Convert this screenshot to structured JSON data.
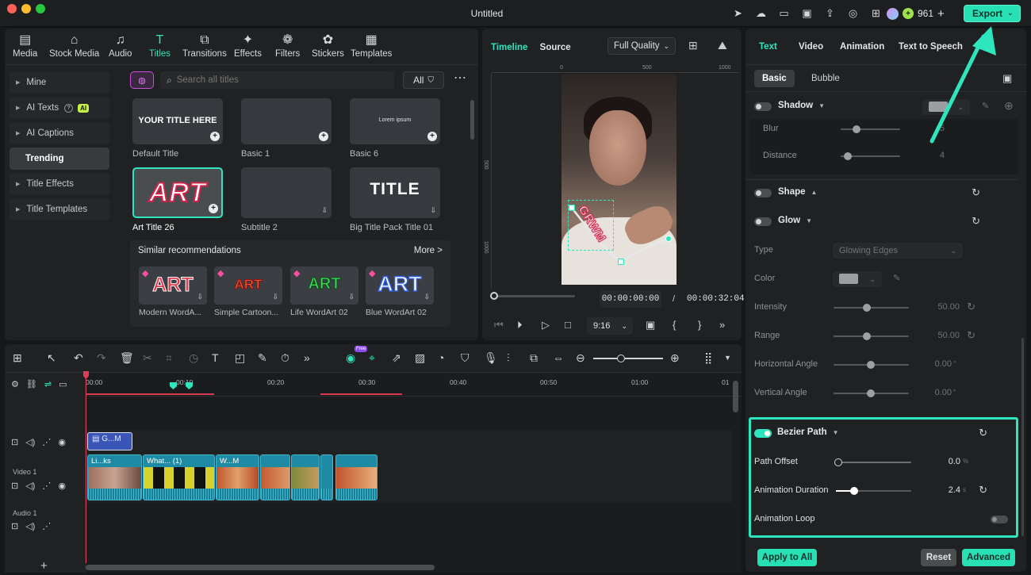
{
  "window": {
    "title": "Untitled"
  },
  "topbar": {
    "credits": "961",
    "credit_plus": "+",
    "export_label": "Export",
    "icons": [
      "send-icon",
      "cloud-sync-icon",
      "monitor-icon",
      "save-icon",
      "cloud-upload-icon",
      "headset-icon",
      "grid-icon"
    ]
  },
  "media_tabs": [
    {
      "label": "Media",
      "icon": "media-icon"
    },
    {
      "label": "Stock Media",
      "icon": "stock-media-icon"
    },
    {
      "label": "Audio",
      "icon": "music-note-icon"
    },
    {
      "label": "Titles",
      "icon": "titles-icon",
      "active": true
    },
    {
      "label": "Transitions",
      "icon": "transitions-icon"
    },
    {
      "label": "Effects",
      "icon": "effects-icon"
    },
    {
      "label": "Filters",
      "icon": "filters-icon"
    },
    {
      "label": "Stickers",
      "icon": "stickers-icon"
    },
    {
      "label": "Templates",
      "icon": "templates-icon"
    }
  ],
  "sidebar": {
    "items": [
      {
        "label": "Mine"
      },
      {
        "label": "AI Texts",
        "badge": "AI"
      },
      {
        "label": "AI Captions"
      },
      {
        "label": "Trending",
        "active": true
      },
      {
        "label": "Title Effects"
      },
      {
        "label": "Title Templates"
      }
    ]
  },
  "search": {
    "placeholder": "Search all titles",
    "filter_label": "All"
  },
  "title_cards": [
    {
      "caption": "Default Title",
      "thumb_text": "YOUR TITLE HERE"
    },
    {
      "caption": "Basic 1",
      "thumb_text": ""
    },
    {
      "caption": "Basic 6",
      "thumb_text": "Lorem ipsum"
    },
    {
      "caption": "Art Title 26",
      "thumb_text": "ART",
      "selected": true
    },
    {
      "caption": "Subtitle 2",
      "thumb_text": ""
    },
    {
      "caption": "Big Title Pack Title 01",
      "thumb_text": "TITLE"
    }
  ],
  "recommendations": {
    "title": "Similar recommendations",
    "more": "More >",
    "items": [
      {
        "caption": "Modern WordA...",
        "thumb_text": "ART",
        "color": "#e33a4d"
      },
      {
        "caption": "Simple Cartoon...",
        "thumb_text": "ART",
        "color": "#f05b2b"
      },
      {
        "caption": "Life WordArt 02",
        "thumb_text": "ART",
        "color": "#3ee05a"
      },
      {
        "caption": "Blue WordArt 02",
        "thumb_text": "ART",
        "color": "#ffffff"
      }
    ]
  },
  "preview": {
    "tabs": [
      "Timeline",
      "Source"
    ],
    "quality": "Full Quality",
    "ruler_h": [
      "0",
      "500",
      "1000"
    ],
    "ruler_v": [
      "500",
      "1000"
    ],
    "overlay_text": "GRWM",
    "current_time": "00:00:00:00",
    "time_sep": "/",
    "total_time": "00:00:32:04",
    "ratio": "9:16"
  },
  "properties": {
    "tabs": [
      "Text",
      "Video",
      "Animation",
      "Text to Speech"
    ],
    "subtabs": [
      "Basic",
      "Bubble"
    ],
    "shadow": {
      "title": "Shadow",
      "blur_label": "Blur",
      "blur_value": "5",
      "distance_label": "Distance",
      "distance_value": "4"
    },
    "shape": {
      "title": "Shape"
    },
    "glow": {
      "title": "Glow",
      "type_label": "Type",
      "type_value": "Glowing Edges",
      "color_label": "Color",
      "intensity_label": "Intensity",
      "intensity_value": "50.00",
      "range_label": "Range",
      "range_value": "50.00",
      "hangle_label": "Horizontal Angle",
      "hangle_value": "0.00",
      "vangle_label": "Vertical Angle",
      "vangle_value": "0.00",
      "deg": "°"
    },
    "bezier": {
      "title": "Bezier Path",
      "offset_label": "Path Offset",
      "offset_value": "0.0",
      "offset_unit": "%",
      "duration_label": "Animation Duration",
      "duration_value": "2.4",
      "duration_unit": "s",
      "loop_label": "Animation Loop"
    },
    "buttons": {
      "apply": "Apply to All",
      "reset": "Reset",
      "advanced": "Advanced"
    }
  },
  "timeline": {
    "ruler": [
      "00:00",
      "00:10",
      "00:20",
      "00:30",
      "00:40",
      "00:50",
      "01:00",
      "01"
    ],
    "tracks": {
      "video1": "Video 1",
      "audio1": "Audio 1"
    },
    "title_clip": "G...M",
    "video_clips": [
      "Li...ks",
      "What... (1)",
      "W...M",
      "",
      "",
      ""
    ],
    "ai_badge": "Free"
  }
}
